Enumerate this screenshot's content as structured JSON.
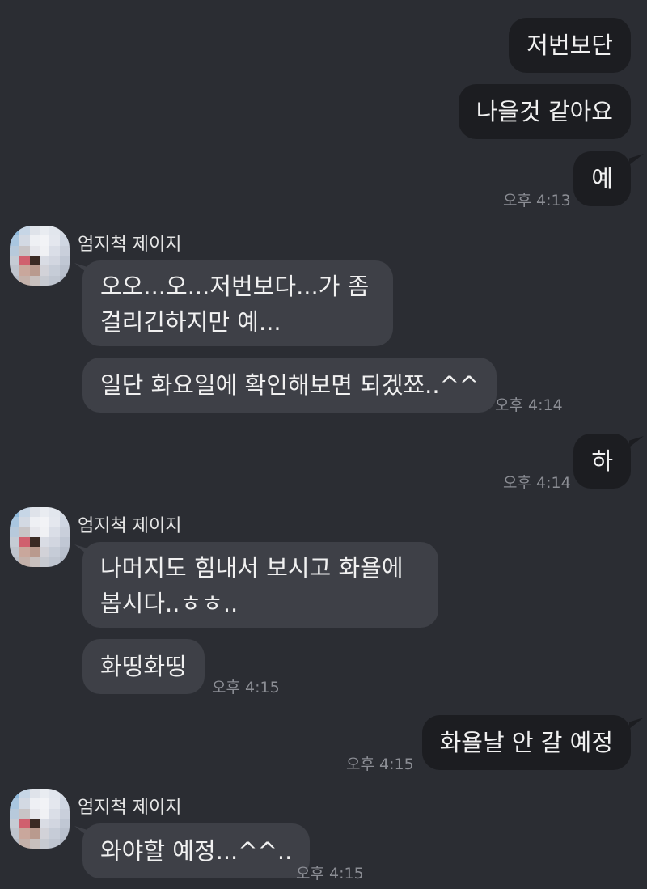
{
  "messages": {
    "m1": "저번보단",
    "m2": "나을것 같아요",
    "m3": "예",
    "t1": "오후 4:13",
    "sender1": "엄지척 제이지",
    "m4_line1": "오오...오...저번보다...가 좀",
    "m4_line2": "걸리긴하지만 예...",
    "m5": "일단 화요일에 확인해보면 되겠쬬..^^",
    "t2": "오후 4:14",
    "m6": "하",
    "t3": "오후 4:14",
    "sender2": "엄지척 제이지",
    "m7_line1": "나머지도 힘내서 보시고 화욜에",
    "m7_line2": "봅시다..ㅎㅎ..",
    "m8": "화띵화띵",
    "t4": "오후 4:15",
    "m9": "화욜날 안 갈 예정",
    "t5": "오후 4:15",
    "sender3": "엄지척 제이지",
    "m10": "와야할 예정...^^..",
    "t6": "오후 4:15"
  },
  "colors": {
    "background": "#2b2d33",
    "outgoing_bubble": "#1c1d21",
    "incoming_bubble": "#3e4047",
    "timestamp": "#8c8e95"
  },
  "icons": {
    "avatar": "pixelated-avatar-icon"
  }
}
